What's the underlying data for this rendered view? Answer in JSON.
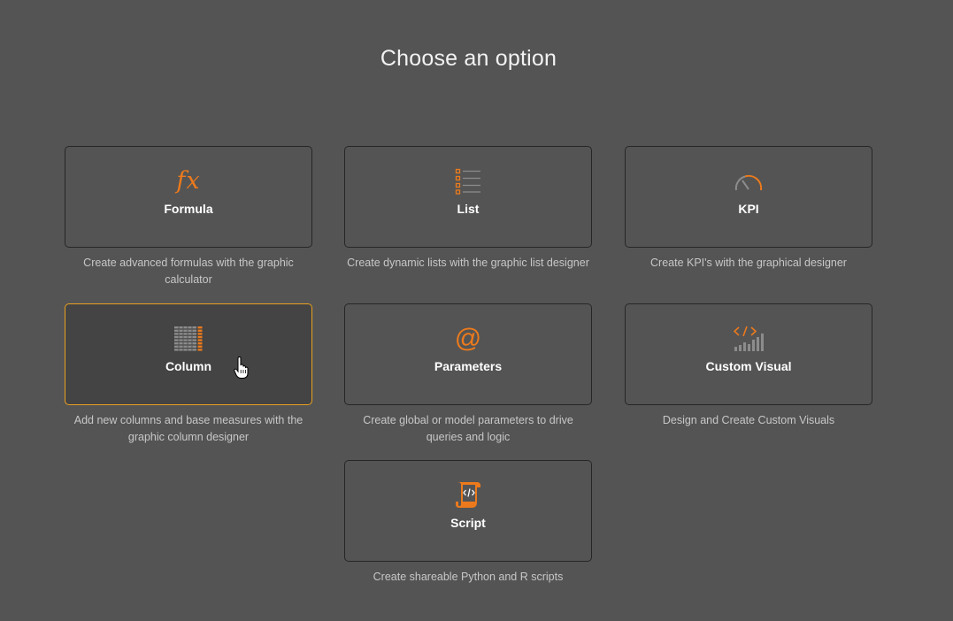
{
  "title": "Choose an option",
  "options": [
    {
      "label": "Formula",
      "description": "Create advanced formulas with the graphic calculator",
      "icon": "fx-icon",
      "icon_text": "fx"
    },
    {
      "label": "List",
      "description": "Create dynamic lists with the graphic list designer",
      "icon": "list-icon"
    },
    {
      "label": "KPI",
      "description": "Create KPI's with the graphical designer",
      "icon": "gauge-icon"
    },
    {
      "label": "Column",
      "description": "Add new columns and base measures with the graphic column designer",
      "icon": "column-grid-icon",
      "selected": true
    },
    {
      "label": "Parameters",
      "description": "Create global or model parameters to drive queries and logic",
      "icon": "at-icon",
      "icon_text": "@"
    },
    {
      "label": "Custom Visual",
      "description": "Design and Create Custom Visuals",
      "icon": "code-chart-icon"
    },
    {
      "label": "Script",
      "description": "Create shareable Python and R scripts",
      "icon": "script-icon"
    }
  ],
  "colors": {
    "background": "#545454",
    "accent": "#ec7a1c",
    "selected_border": "#e8a01f",
    "card_border": "#262626",
    "description_text": "#c7c7c7"
  }
}
